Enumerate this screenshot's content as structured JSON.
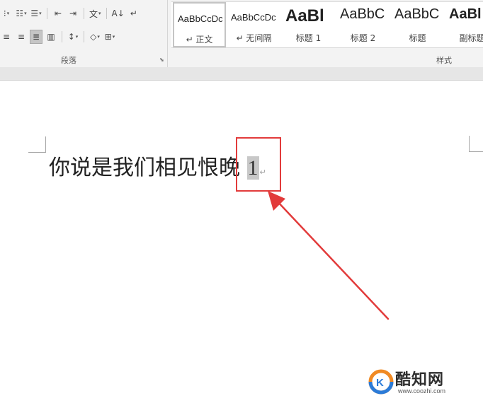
{
  "ribbon": {
    "paragraph_group": {
      "label": "段落",
      "row1": [
        {
          "icon": "bullets-dropdown-icon",
          "glyph": "⁝",
          "dropdown": true
        },
        {
          "icon": "numbering-icon",
          "glyph": "☷",
          "dropdown": true
        },
        {
          "icon": "multilevel-list-icon",
          "glyph": "☰",
          "dropdown": true
        },
        {
          "icon": "decrease-indent-icon",
          "glyph": "⇤"
        },
        {
          "icon": "increase-indent-icon",
          "glyph": "⇥"
        },
        {
          "icon": "chinese-layout-icon",
          "glyph": "文",
          "dropdown": true
        },
        {
          "icon": "sort-icon",
          "glyph": "A↓"
        },
        {
          "icon": "show-marks-icon",
          "glyph": "↵"
        }
      ],
      "row2": [
        {
          "icon": "align-left-icon",
          "glyph": "≡"
        },
        {
          "icon": "align-right-icon",
          "glyph": "≡"
        },
        {
          "icon": "justify-icon",
          "glyph": "≣",
          "selected": true
        },
        {
          "icon": "distributed-icon",
          "glyph": "▥"
        },
        {
          "icon": "line-spacing-icon",
          "glyph": "↕",
          "dropdown": true
        },
        {
          "icon": "shading-icon",
          "glyph": "◇",
          "dropdown": true
        },
        {
          "icon": "borders-icon",
          "glyph": "⊞",
          "dropdown": true
        }
      ]
    },
    "styles_group": {
      "label": "样式",
      "items": [
        {
          "sample": "AaBbCcDc",
          "name": "↵ 正文",
          "size": 13,
          "bold": false,
          "active": true
        },
        {
          "sample": "AaBbCcDc",
          "name": "↵ 无间隔",
          "size": 13,
          "bold": false,
          "active": false
        },
        {
          "sample": "AaBl",
          "name": "标题 1",
          "size": 24,
          "bold": true,
          "active": false
        },
        {
          "sample": "AaBbC",
          "name": "标题 2",
          "size": 20,
          "bold": false,
          "active": false
        },
        {
          "sample": "AaBbC",
          "name": "标题",
          "size": 20,
          "bold": false,
          "active": false
        },
        {
          "sample": "AaBl",
          "name": "副标题",
          "size": 20,
          "bold": true,
          "active": false
        }
      ]
    }
  },
  "document": {
    "text": "你说是我们相见恨晚",
    "number": "1",
    "paragraph_mark": "↵"
  },
  "annotation": {
    "box_color": "#e23b3b",
    "arrow_color": "#e23b3b"
  },
  "watermark": {
    "name": "酷知网",
    "url": "www.coozhi.com",
    "logo_letter": "K"
  }
}
